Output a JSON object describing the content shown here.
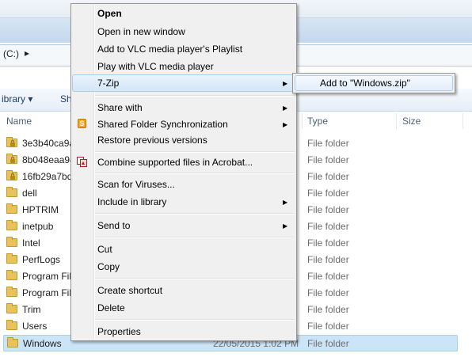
{
  "address": {
    "path": "(C:)",
    "chevron": "▸"
  },
  "toolbar": {
    "organize_label": "ibrary ▾",
    "share_label": "Sh"
  },
  "columns": {
    "name": "Name",
    "type": "Type",
    "size": "Size"
  },
  "files": [
    {
      "name": "3e3b40ca9a",
      "type": "File folder",
      "locked": true
    },
    {
      "name": "8b048eaa94",
      "type": "File folder",
      "locked": true
    },
    {
      "name": "16fb29a7bd",
      "type": "File folder",
      "locked": true
    },
    {
      "name": "dell",
      "type": "File folder",
      "locked": false
    },
    {
      "name": "HPTRIM",
      "type": "File folder",
      "locked": false
    },
    {
      "name": "inetpub",
      "type": "File folder",
      "locked": false
    },
    {
      "name": "Intel",
      "type": "File folder",
      "locked": false
    },
    {
      "name": "PerfLogs",
      "type": "File folder",
      "locked": false
    },
    {
      "name": "Program Fil",
      "type": "File folder",
      "locked": false
    },
    {
      "name": "Program Fil",
      "type": "File folder",
      "locked": false
    },
    {
      "name": "Trim",
      "type": "File folder",
      "locked": false
    },
    {
      "name": "Users",
      "type": "File folder",
      "locked": false
    },
    {
      "name": "Windows",
      "type": "File folder",
      "locked": false,
      "date": "22/05/2015 1:02 PM",
      "selected": true
    }
  ],
  "context_menu": {
    "open": "Open",
    "open_new_window": "Open in new window",
    "vlc_playlist": "Add to VLC media player's Playlist",
    "vlc_play": "Play with VLC media player",
    "seven_zip": "7-Zip",
    "share_with": "Share with",
    "shared_folder_sync": "Shared Folder Synchronization",
    "restore_versions": "Restore previous versions",
    "acrobat_combine": "Combine supported files in Acrobat...",
    "scan_viruses": "Scan for Viruses...",
    "include_library": "Include in library",
    "send_to": "Send to",
    "cut": "Cut",
    "copy": "Copy",
    "create_shortcut": "Create shortcut",
    "delete": "Delete",
    "properties": "Properties",
    "arrow": "▶"
  },
  "submenu": {
    "add_to_zip": "Add to \"Windows.zip\""
  },
  "colors": {
    "selection": "#cce4f7",
    "menu_bg": "#f0f0f0",
    "highlight_border": "#aecde8"
  }
}
